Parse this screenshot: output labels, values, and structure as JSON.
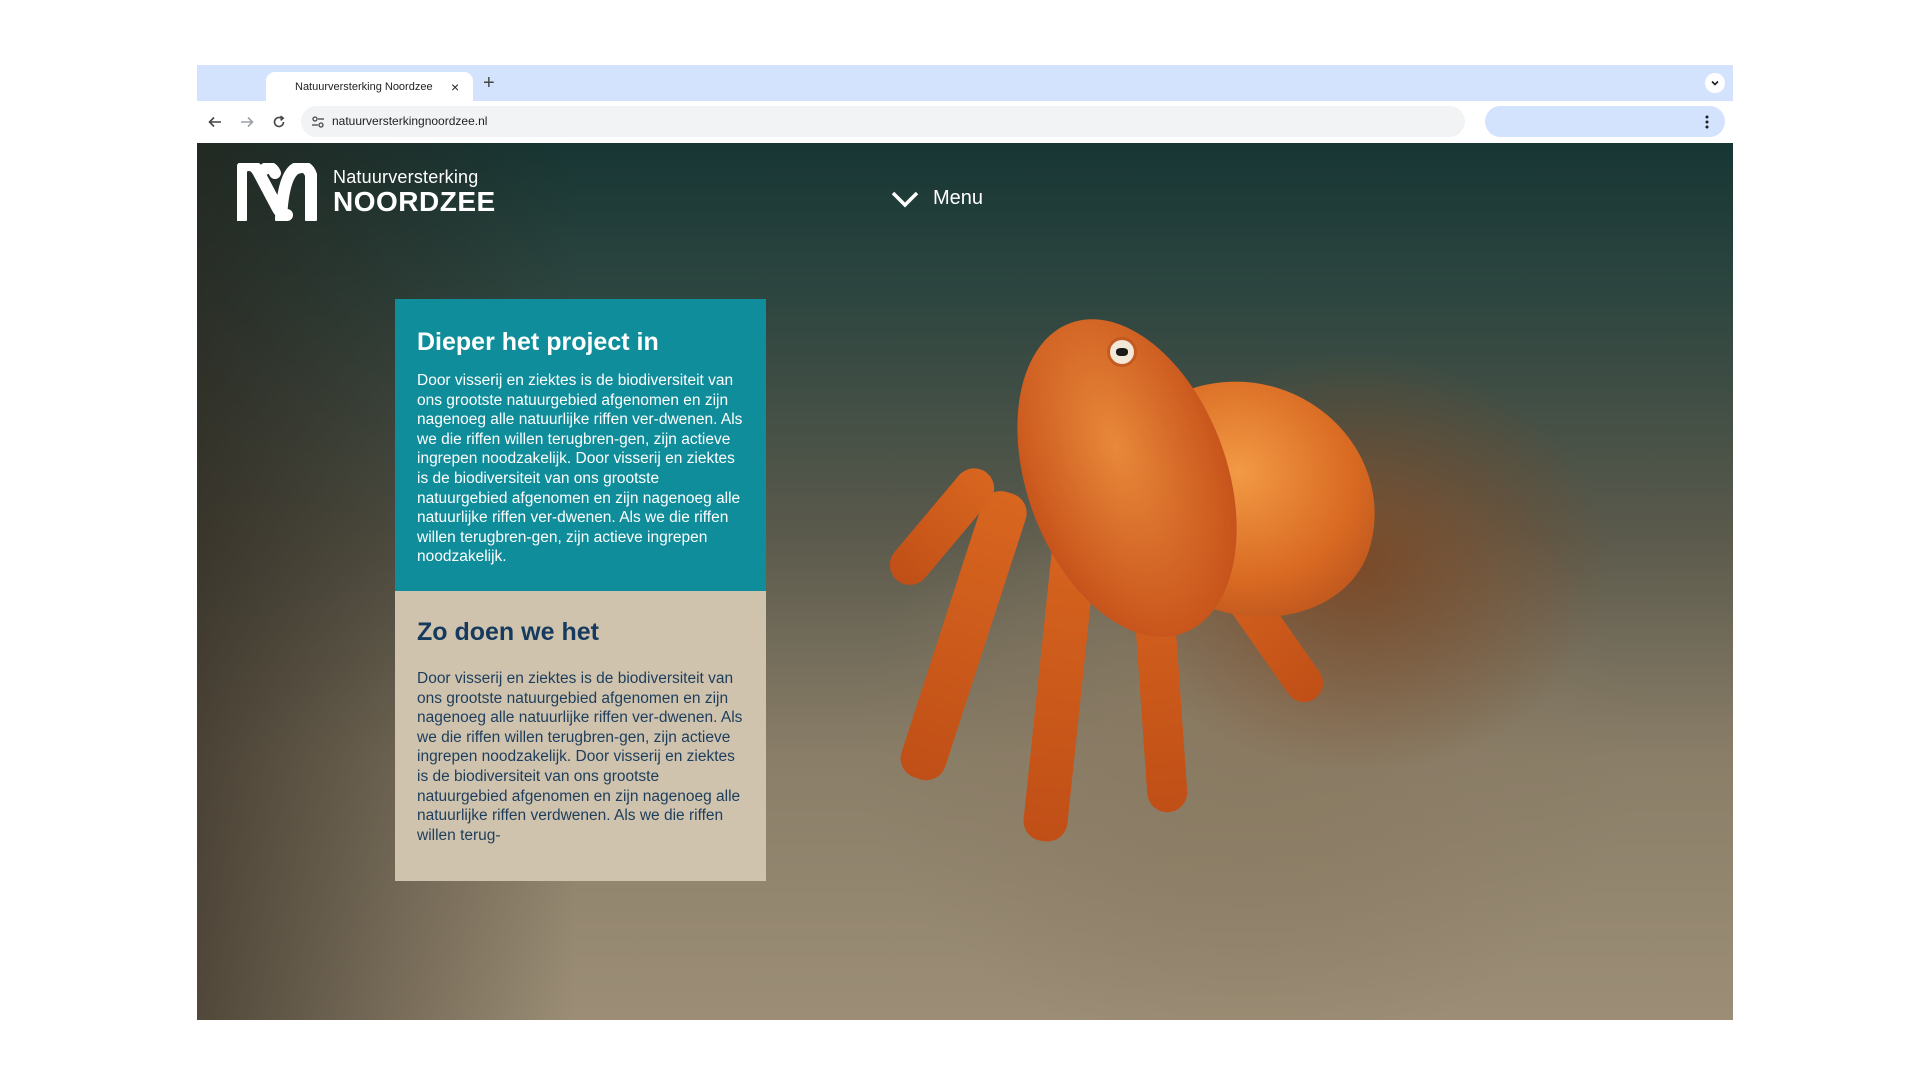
{
  "browser": {
    "tab_title": "Natuurversterking Noordzee",
    "close_glyph": "×",
    "new_tab_glyph": "+",
    "url": "natuurversterkingnoordzee.nl"
  },
  "site": {
    "logo_line1": "Natuurversterking",
    "logo_line2": "NOORDZEE",
    "menu_label": "Menu"
  },
  "panels": [
    {
      "title": "Dieper het project in",
      "body": "Door visserij en ziektes is de biodiversiteit van ons grootste natuurgebied afgenomen en zijn nagenoeg alle natuurlijke riffen ver-dwenen. Als we die riffen willen terugbren-gen, zijn actieve ingrepen noodzakelijk. Door visserij en ziektes is de biodiversiteit van ons grootste natuurgebied afgenomen en zijn nagenoeg alle natuurlijke riffen ver-dwenen. Als we die riffen willen terugbren-gen, zijn actieve ingrepen noodzakelijk.",
      "color": "#0f8d9b"
    },
    {
      "title": "Zo doen we het",
      "body": "Door visserij en ziektes is de biodiversiteit van ons grootste natuurgebied afgenomen en zijn nagenoeg alle natuurlijke riffen ver-dwenen. Als we die riffen willen terugbren-gen, zijn actieve ingrepen noodzakelijk. Door visserij en ziektes is de biodiversiteit van ons grootste natuurgebied afgenomen en zijn nagenoeg alle natuurlijke riffen verdwenen. Als we die riffen willen terug-",
      "color": "#cfc3ae"
    }
  ],
  "icons": [
    "back-arrow-icon",
    "forward-arrow-icon",
    "reload-icon",
    "site-info-icon",
    "kebab-menu-icon",
    "chevron-down-icon",
    "logo-mark-icon"
  ]
}
